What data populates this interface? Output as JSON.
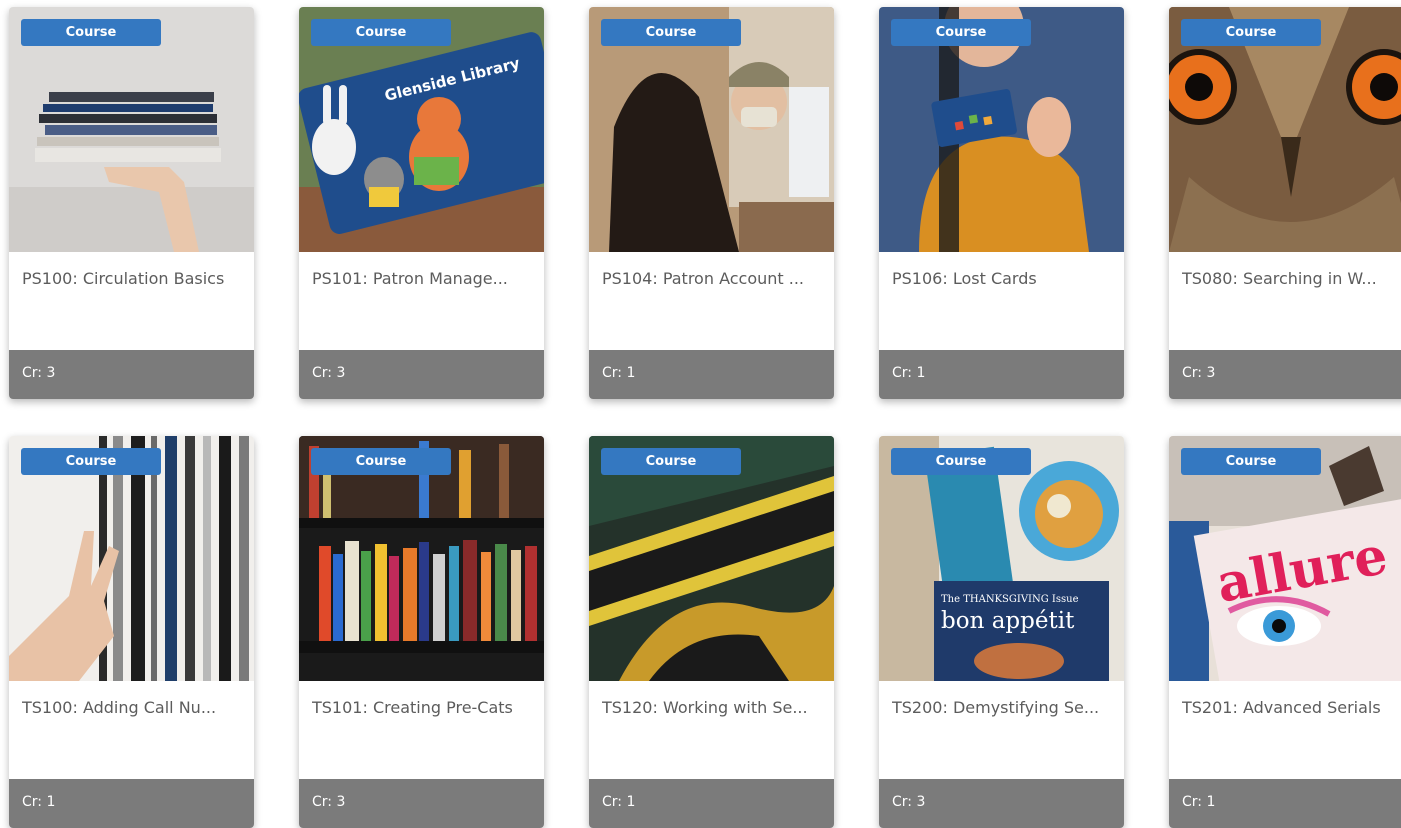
{
  "badge_label": "Course",
  "colors": {
    "badge": "#3478c1",
    "footer": "#7b7b7b",
    "title": "#5c5c5c"
  },
  "courses": [
    {
      "title": "PS100: Circulation Basics",
      "credits": "Cr: 3",
      "image": "stack-of-books-held-by-hand"
    },
    {
      "title": "PS101: Patron Manage...",
      "credits": "Cr: 3",
      "image": "glenside-library-card-with-animals"
    },
    {
      "title": "PS104: Patron Account ...",
      "credits": "Cr: 1",
      "image": "patron-at-circulation-desk"
    },
    {
      "title": "PS106: Lost Cards",
      "credits": "Cr: 1",
      "image": "person-holding-library-card"
    },
    {
      "title": "TS080: Searching in W...",
      "credits": "Cr: 3",
      "image": "owl-eyes-closeup"
    },
    {
      "title": "TS100: Adding Call Nu...",
      "credits": "Cr: 1",
      "image": "hand-reaching-book-spines"
    },
    {
      "title": "TS101: Creating Pre-Cats",
      "credits": "Cr: 3",
      "image": "bookshelf-full-of-books"
    },
    {
      "title": "TS120: Working with Se...",
      "credits": "Cr: 1",
      "image": "comic-magazine-cover"
    },
    {
      "title": "TS200: Demystifying Se...",
      "credits": "Cr: 3",
      "image": "magazine-collage"
    },
    {
      "title": "TS201: Advanced Serials",
      "credits": "Cr: 1",
      "image": "allure-magazine-cover"
    }
  ],
  "image_text": {
    "library_card": "Glenside Library",
    "magazine_bon": "bon appétit",
    "magazine_thanks": "The THANKSGIVING Issue",
    "magazine_allure": "allure"
  }
}
